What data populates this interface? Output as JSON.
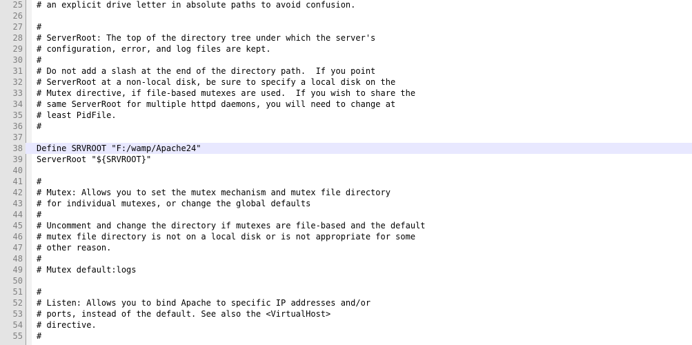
{
  "editor": {
    "lines": [
      {
        "num": "25",
        "text": "# an explicit drive letter in absolute paths to avoid confusion."
      },
      {
        "num": "26",
        "text": ""
      },
      {
        "num": "27",
        "text": "#"
      },
      {
        "num": "28",
        "text": "# ServerRoot: The top of the directory tree under which the server's"
      },
      {
        "num": "29",
        "text": "# configuration, error, and log files are kept."
      },
      {
        "num": "30",
        "text": "#"
      },
      {
        "num": "31",
        "text": "# Do not add a slash at the end of the directory path.  If you point"
      },
      {
        "num": "32",
        "text": "# ServerRoot at a non-local disk, be sure to specify a local disk on the"
      },
      {
        "num": "33",
        "text": "# Mutex directive, if file-based mutexes are used.  If you wish to share the"
      },
      {
        "num": "34",
        "text": "# same ServerRoot for multiple httpd daemons, you will need to change at"
      },
      {
        "num": "35",
        "text": "# least PidFile."
      },
      {
        "num": "36",
        "text": "#"
      },
      {
        "num": "37",
        "text": ""
      },
      {
        "num": "38",
        "text": "Define SRVROOT \"F:/wamp/Apache24\""
      },
      {
        "num": "39",
        "text": "ServerRoot \"${SRVROOT}\""
      },
      {
        "num": "40",
        "text": ""
      },
      {
        "num": "41",
        "text": "#"
      },
      {
        "num": "42",
        "text": "# Mutex: Allows you to set the mutex mechanism and mutex file directory"
      },
      {
        "num": "43",
        "text": "# for individual mutexes, or change the global defaults"
      },
      {
        "num": "44",
        "text": "#"
      },
      {
        "num": "45",
        "text": "# Uncomment and change the directory if mutexes are file-based and the default"
      },
      {
        "num": "46",
        "text": "# mutex file directory is not on a local disk or is not appropriate for some"
      },
      {
        "num": "47",
        "text": "# other reason."
      },
      {
        "num": "48",
        "text": "#"
      },
      {
        "num": "49",
        "text": "# Mutex default:logs"
      },
      {
        "num": "50",
        "text": ""
      },
      {
        "num": "51",
        "text": "#"
      },
      {
        "num": "52",
        "text": "# Listen: Allows you to bind Apache to specific IP addresses and/or"
      },
      {
        "num": "53",
        "text": "# ports, instead of the default. See also the <VirtualHost>"
      },
      {
        "num": "54",
        "text": "# directive."
      },
      {
        "num": "55",
        "text": "#"
      }
    ]
  },
  "colors": {
    "current_line": "#e8e8ff",
    "gutter_bg": "#e4e4e4",
    "line_number": "#808080",
    "text": "#000000"
  }
}
